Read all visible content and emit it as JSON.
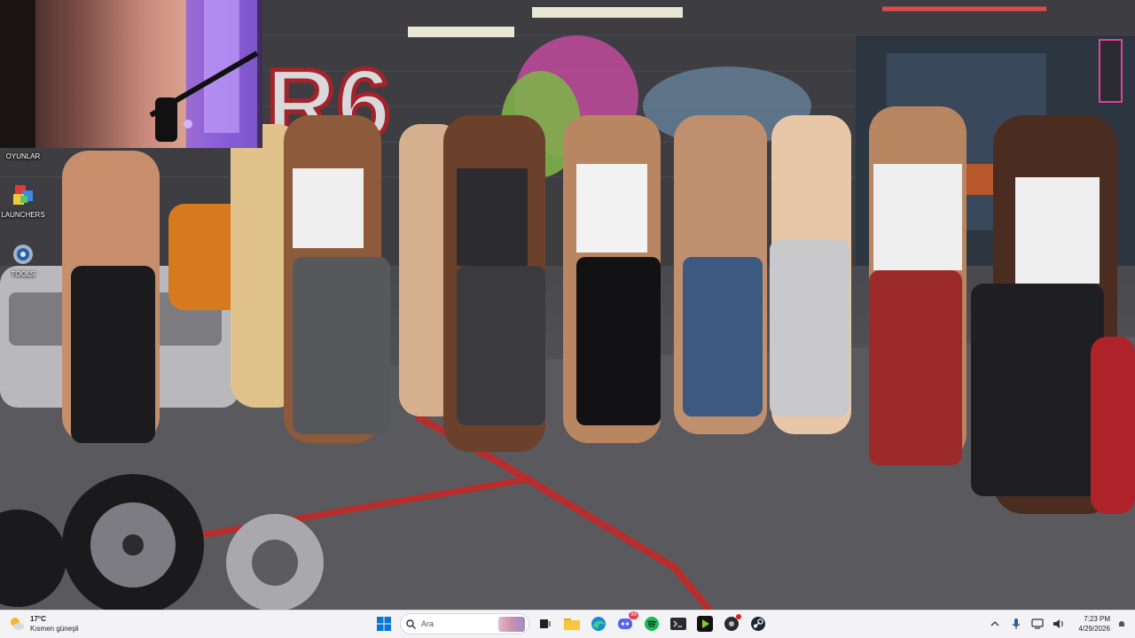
{
  "desktop": {
    "icons": [
      {
        "label": "OYUNLAR"
      },
      {
        "label": "LAUNCHERS"
      },
      {
        "label": "TOOLS"
      }
    ]
  },
  "wallpaper": {
    "mural_text": "R6"
  },
  "taskbar": {
    "weather": {
      "temp": "17°C",
      "condition": "Kısmen güneşli"
    },
    "search": {
      "placeholder": "Ara"
    },
    "apps": [
      {
        "name": "windows-start",
        "icon": "windows-logo"
      },
      {
        "name": "search",
        "icon": "search-icon"
      },
      {
        "name": "task-view",
        "icon": "task-view-icon"
      },
      {
        "name": "file-explorer",
        "icon": "folder-icon"
      },
      {
        "name": "edge",
        "icon": "edge-icon"
      },
      {
        "name": "discord",
        "icon": "discord-icon",
        "badge": "99"
      },
      {
        "name": "spotify",
        "icon": "spotify-icon"
      },
      {
        "name": "terminal",
        "icon": "terminal-icon"
      },
      {
        "name": "media",
        "icon": "media-icon"
      },
      {
        "name": "app-red-dot",
        "icon": "app-icon"
      },
      {
        "name": "steam",
        "icon": "steam-icon"
      }
    ],
    "tray": {
      "time": "7:23 PM",
      "date": "4/29/2026"
    }
  },
  "colors": {
    "taskbar_bg": "#f3f3f5",
    "accent_blue": "#0067c0",
    "spotify_green": "#1db954"
  }
}
